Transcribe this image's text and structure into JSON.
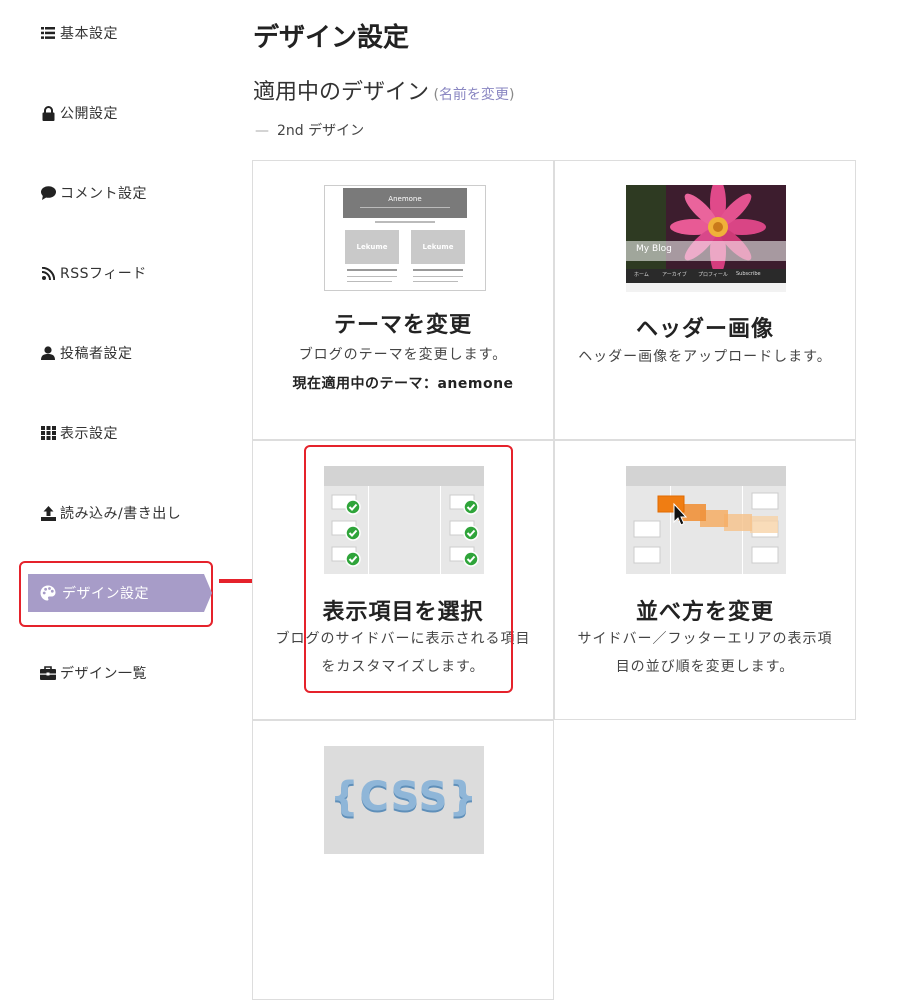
{
  "sidebar": {
    "items": [
      {
        "label": "基本設定",
        "icon": "list-icon"
      },
      {
        "label": "公開設定",
        "icon": "lock-icon"
      },
      {
        "label": "コメント設定",
        "icon": "comment-icon"
      },
      {
        "label": "RSSフィード",
        "icon": "rss-icon"
      },
      {
        "label": "投稿者設定",
        "icon": "user-icon"
      },
      {
        "label": "表示設定",
        "icon": "grid-icon"
      },
      {
        "label": "読み込み/書き出し",
        "icon": "upload-icon"
      },
      {
        "label": "デザイン設定",
        "icon": "palette-icon",
        "active": true
      },
      {
        "label": "デザイン一覧",
        "icon": "briefcase-icon"
      }
    ]
  },
  "main": {
    "title": "デザイン設定",
    "current_label": "適用中のデザイン",
    "rename_link": "名前を変更",
    "design_name": "2nd デザイン"
  },
  "cards": {
    "theme": {
      "title": "テーマを変更",
      "desc": "ブログのテーマを変更します。",
      "current": "現在適用中のテーマ：anemone",
      "thumb_title": "Anemone",
      "thumb_box1": "Lekume",
      "thumb_box2": "Lekume"
    },
    "header": {
      "title": "ヘッダー画像",
      "desc": "ヘッダー画像をアップロードします。",
      "thumb_text": "My Blog",
      "thumb_nav": [
        "ホーム",
        "アーカイブ",
        "プロフィール",
        "Subscribe"
      ]
    },
    "items": {
      "title": "表示項目を選択",
      "desc": "ブログのサイドバーに表示される項目をカスタマイズします。"
    },
    "order": {
      "title": "並べ方を変更",
      "desc": "サイドバー／フッターエリアの表示項目の並び順を変更します。"
    },
    "css": {
      "thumb_text": "{CSS}"
    }
  },
  "colors": {
    "accent": "#a79cc8",
    "highlight": "#e5222b",
    "link": "#8a87c2"
  }
}
